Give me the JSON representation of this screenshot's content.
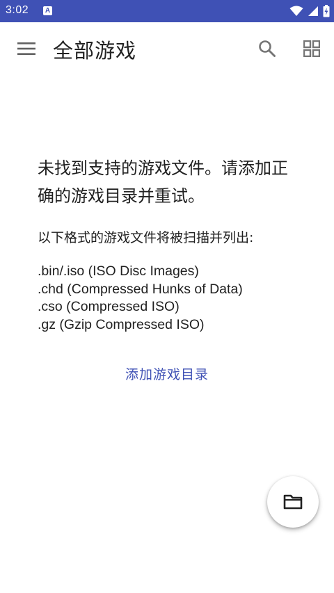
{
  "status_bar": {
    "time": "3:02",
    "app_icon_letter": "A"
  },
  "app_bar": {
    "title": "全部游戏",
    "menu_icon": "hamburger-menu-icon",
    "search_icon": "search-icon",
    "view_icon": "grid-view-icon"
  },
  "empty_state": {
    "message": "未找到支持的游戏文件。请添加正确的游戏目录并重试。",
    "formats_heading": "以下格式的游戏文件将被扫描并列出:",
    "formats": [
      ".bin/.iso (ISO Disc Images)",
      ".chd (Compressed Hunks of Data)",
      ".cso (Compressed ISO)",
      ".gz (Gzip Compressed ISO)"
    ],
    "add_directory_label": "添加游戏目录"
  },
  "fab": {
    "icon": "folder-icon"
  },
  "colors": {
    "primary": "#3f51b5",
    "text": "#212121",
    "icon": "#757575"
  }
}
